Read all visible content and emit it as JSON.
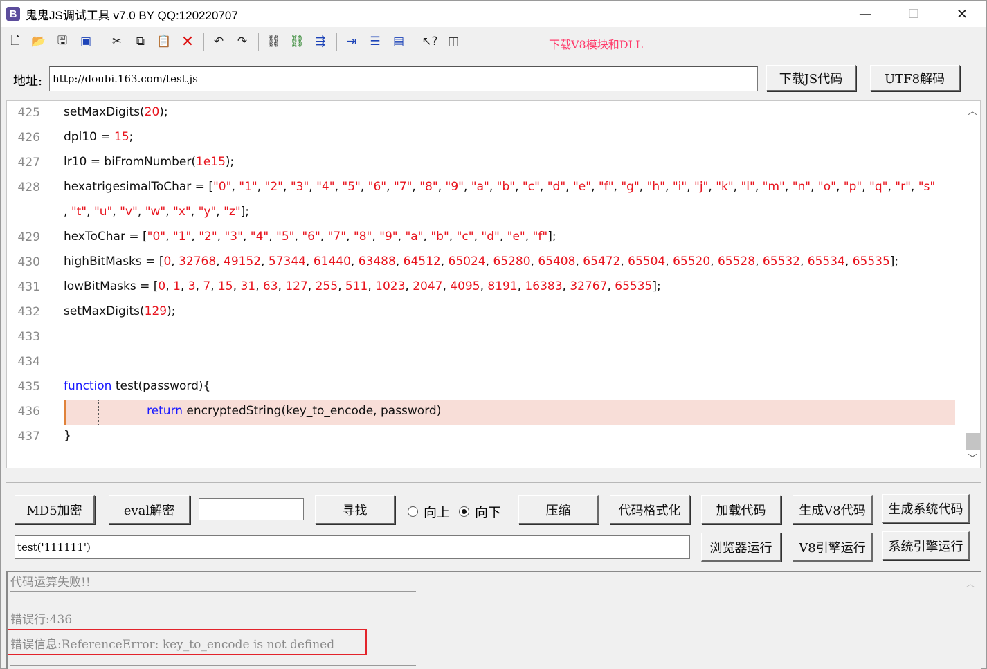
{
  "window": {
    "icon_letter": "B",
    "title": "鬼鬼JS调试工具 v7.0 BY QQ:120220707",
    "minimize": "—",
    "maximize": "☐",
    "close": "✕"
  },
  "toolbar": {
    "buttons": [
      "new-file-icon",
      "open-folder-icon",
      "save-icon",
      "save-all-icon",
      "cut-icon",
      "copy-icon",
      "paste-icon",
      "delete-icon",
      "undo-icon",
      "redo-icon",
      "find-icon",
      "find-next-icon",
      "list-icon",
      "indent-icon",
      "numbered-list-icon",
      "window-icon",
      "help-pointer-icon",
      "panel-icon"
    ],
    "download_link": "下载V8模块和DLL"
  },
  "address": {
    "label": "地址:",
    "value": "http://doubi.163.com/test.js",
    "download_button": "下载JS代码",
    "utf8_button": "UTF8解码"
  },
  "editor": {
    "lines": [
      {
        "n": "425",
        "text": "setMaxDigits(20);"
      },
      {
        "n": "426",
        "text": "dpl10 = 15;"
      },
      {
        "n": "427",
        "text": "lr10 = biFromNumber(1e15);"
      },
      {
        "n": "428",
        "text": "hexatrigesimalToChar = [\"0\", \"1\", \"2\", \"3\", \"4\", \"5\", \"6\", \"7\", \"8\", \"9\", \"a\", \"b\", \"c\", \"d\", \"e\", \"f\", \"g\", \"h\", \"i\", \"j\", \"k\", \"l\", \"m\", \"n\", \"o\", \"p\", \"q\", \"r\", \"s\""
      },
      {
        "n": "",
        "text": ", \"t\", \"u\", \"v\", \"w\", \"x\", \"y\", \"z\"];"
      },
      {
        "n": "429",
        "text": "hexToChar = [\"0\", \"1\", \"2\", \"3\", \"4\", \"5\", \"6\", \"7\", \"8\", \"9\", \"a\", \"b\", \"c\", \"d\", \"e\", \"f\"];"
      },
      {
        "n": "430",
        "text": "highBitMasks = [0, 32768, 49152, 57344, 61440, 63488, 64512, 65024, 65280, 65408, 65472, 65504, 65520, 65528, 65532, 65534, 65535];"
      },
      {
        "n": "431",
        "text": "lowBitMasks = [0, 1, 3, 7, 15, 31, 63, 127, 255, 511, 1023, 2047, 4095, 8191, 16383, 32767, 65535];"
      },
      {
        "n": "432",
        "text": "setMaxDigits(129);"
      },
      {
        "n": "433",
        "text": ""
      },
      {
        "n": "434",
        "text": ""
      },
      {
        "n": "435",
        "text": "function test(password){"
      },
      {
        "n": "436",
        "text": "return encryptedString(key_to_encode, password)"
      },
      {
        "n": "437",
        "text": "}"
      }
    ],
    "highlighted_line": 12,
    "scroll_up": "︿",
    "scroll_down": "﹀"
  },
  "controls": {
    "md5_button": "MD5加密",
    "eval_button": "eval解密",
    "search_value": "",
    "find_button": "寻找",
    "radio_up": "向上",
    "radio_down": "向下",
    "radio_selected": "向下",
    "compress_button": "压缩",
    "format_button": "代码格式化",
    "load_button": "加载代码",
    "gen_v8_button": "生成V8代码",
    "gen_sys_button": "生成系统代码",
    "command_value": "test('111111')",
    "browser_run_button": "浏览器运行",
    "v8_run_button": "V8引擎运行",
    "sys_run_button": "系统引擎运行"
  },
  "output": {
    "status": "代码运算失败!!",
    "error_line": "错误行:436",
    "error_message": "错误信息:ReferenceError: key_to_encode is not defined",
    "scroll_up": "︿"
  },
  "colors": {
    "keyword": "#1a1aff",
    "number_string": "#e8141e",
    "highlight_bg": "#f8ded8",
    "download_link": "#ff3b6b",
    "error_box": "#e3242b"
  }
}
